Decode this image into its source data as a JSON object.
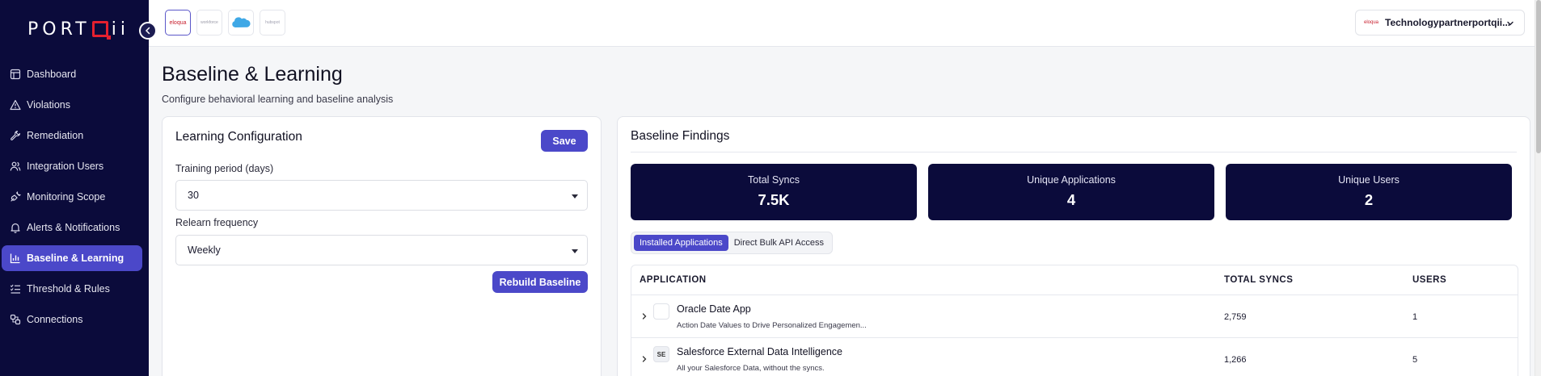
{
  "brand": {
    "left": "PORT",
    "right": "ii"
  },
  "sidebar": {
    "items": [
      {
        "label": "Dashboard",
        "icon": "dashboard-icon",
        "active": false
      },
      {
        "label": "Violations",
        "icon": "warning-triangle-icon",
        "active": false
      },
      {
        "label": "Remediation",
        "icon": "wrench-icon",
        "active": false
      },
      {
        "label": "Integration Users",
        "icon": "users-icon",
        "active": false
      },
      {
        "label": "Monitoring Scope",
        "icon": "plug-icon",
        "active": false
      },
      {
        "label": "Alerts & Notifications",
        "icon": "bell-icon",
        "active": false
      },
      {
        "label": "Baseline & Learning",
        "icon": "bar-chart-icon",
        "active": true
      },
      {
        "label": "Threshold & Rules",
        "icon": "list-check-icon",
        "active": false
      },
      {
        "label": "Connections",
        "icon": "link-icon",
        "active": false
      }
    ]
  },
  "topbar": {
    "org_logos": [
      "eloqua",
      "workforce",
      "salesforce",
      "hubspot"
    ],
    "tenant": {
      "logo_text": "eloqua",
      "name": "Technologypartnerportqii..."
    }
  },
  "page": {
    "title": "Baseline & Learning",
    "subtitle": "Configure behavioral learning and baseline analysis"
  },
  "learning": {
    "title": "Learning Configuration",
    "save_label": "Save",
    "training_label": "Training period (days)",
    "training_value": "30",
    "relearn_label": "Relearn frequency",
    "relearn_value": "Weekly",
    "rebuild_label": "Rebuild Baseline"
  },
  "findings": {
    "title": "Baseline Findings",
    "stats": [
      {
        "label": "Total Syncs",
        "value": "7.5K"
      },
      {
        "label": "Unique Applications",
        "value": "4"
      },
      {
        "label": "Unique Users",
        "value": "2"
      }
    ],
    "tabs": [
      "Installed Applications",
      "Direct Bulk API Access"
    ],
    "active_tab": 0,
    "columns": [
      "APPLICATION",
      "TOTAL SYNCS",
      "USERS"
    ],
    "rows": [
      {
        "icon": "",
        "name": "Oracle Date App",
        "desc": "Action Date Values to Drive Personalized Engagemen...",
        "syncs": "2,759",
        "users": "1"
      },
      {
        "icon": "SE",
        "name": "Salesforce External Data Intelligence",
        "desc": "All your Salesforce Data, without the syncs.",
        "syncs": "1,266",
        "users": "5"
      }
    ]
  },
  "colors": {
    "sidebar_bg": "#0b0b3b",
    "accent": "#4b48c9",
    "brand_red": "#e5202f"
  }
}
